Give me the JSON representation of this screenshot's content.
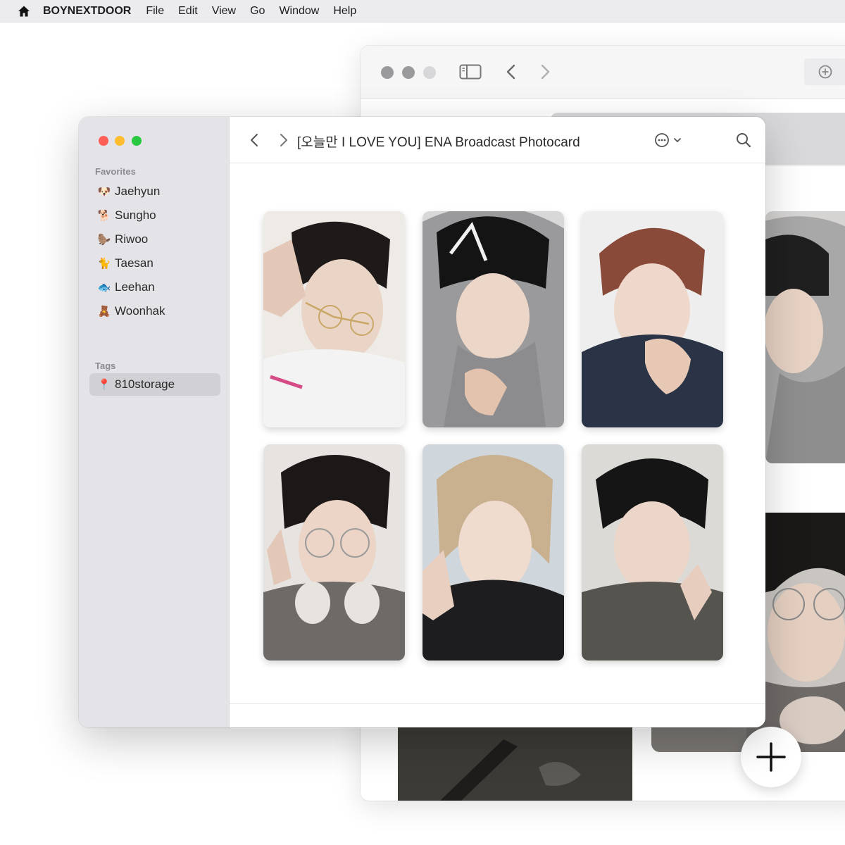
{
  "menubar": {
    "app_name": "BOYNEXTDOOR",
    "items": [
      "File",
      "Edit",
      "View",
      "Go",
      "Window",
      "Help"
    ]
  },
  "finder": {
    "title": "[오늘만 I LOVE YOU] ENA Broadcast Photocard",
    "sidebar": {
      "favorites_title": "Favorites",
      "favorites": [
        {
          "emoji": "🐶",
          "label": "Jaehyun"
        },
        {
          "emoji": "🐕",
          "label": "Sungho"
        },
        {
          "emoji": "🦫",
          "label": "Riwoo"
        },
        {
          "emoji": "🐈",
          "label": "Taesan"
        },
        {
          "emoji": "🐟",
          "label": "Leehan"
        },
        {
          "emoji": "🧸",
          "label": "Woonhak"
        }
      ],
      "tags_title": "Tags",
      "tags": [
        {
          "emoji": "📍",
          "label": "810storage",
          "selected": true
        }
      ]
    },
    "photocards": [
      {
        "subject": "white hoodie, glasses, peace sign",
        "bg": "#eeeae6",
        "hair": "#1e1a1a",
        "top": "#f3f3f3"
      },
      {
        "subject": "gray hoodie, black beanie",
        "bg": "#d8d8d8",
        "hair": "#141414",
        "top": "#9a9a9c"
      },
      {
        "subject": "reddish hair, denim jacket",
        "bg": "#efeeee",
        "hair": "#8a4a3a",
        "top": "#2a3446"
      },
      {
        "subject": "glasses, headphones, gray coat",
        "bg": "#e6e3e0",
        "hair": "#1c1818",
        "top": "#6d6a68"
      },
      {
        "subject": "blonde hair, black jacket",
        "bg": "#cfd6dc",
        "hair": "#c9b08f",
        "top": "#1d1d1f"
      },
      {
        "subject": "black hair, olive jacket, peace sign",
        "bg": "#dcdad6",
        "hair": "#151515",
        "top": "#55544f"
      }
    ]
  },
  "colors": {
    "menubar_bg": "#ececee",
    "sidebar_bg": "#e4e4e8",
    "traffic_red": "#ff5f57",
    "traffic_yellow": "#febc2e",
    "traffic_green": "#28c840"
  }
}
